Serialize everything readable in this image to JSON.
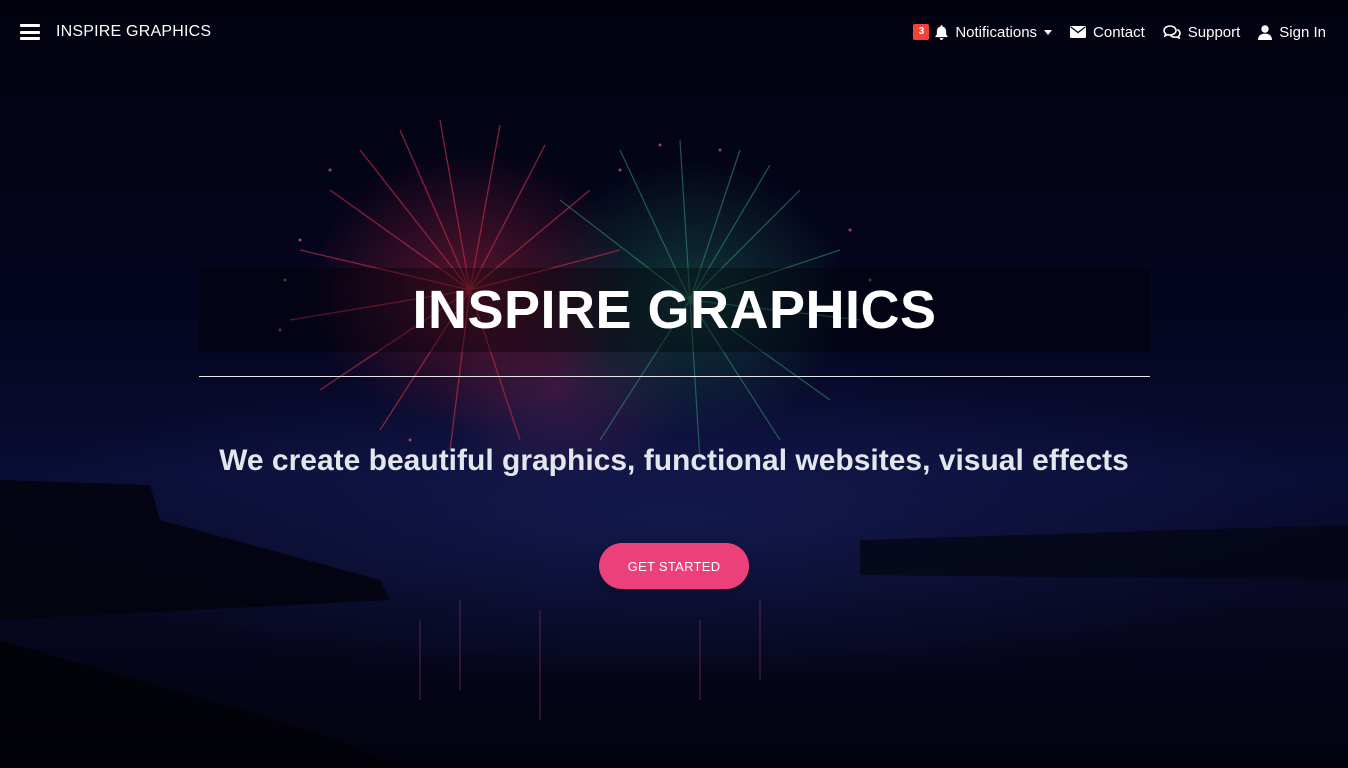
{
  "navbar": {
    "brand": "INSPIRE GRAPHICS",
    "menu_icon": "hamburger-icon",
    "items": [
      {
        "label": "Notifications",
        "icon": "bell-icon",
        "badge": "3",
        "dropdown": true
      },
      {
        "label": "Contact",
        "icon": "envelope-icon"
      },
      {
        "label": "Support",
        "icon": "comments-icon"
      },
      {
        "label": "Sign In",
        "icon": "user-icon"
      }
    ]
  },
  "hero": {
    "title": "INSPIRE GRAPHICS",
    "subtitle": "We create beautiful graphics, functional websites, visual effects",
    "cta_label": "GET STARTED"
  },
  "colors": {
    "accent": "#ec407a",
    "badge": "#f44336",
    "background": "#05061a"
  }
}
